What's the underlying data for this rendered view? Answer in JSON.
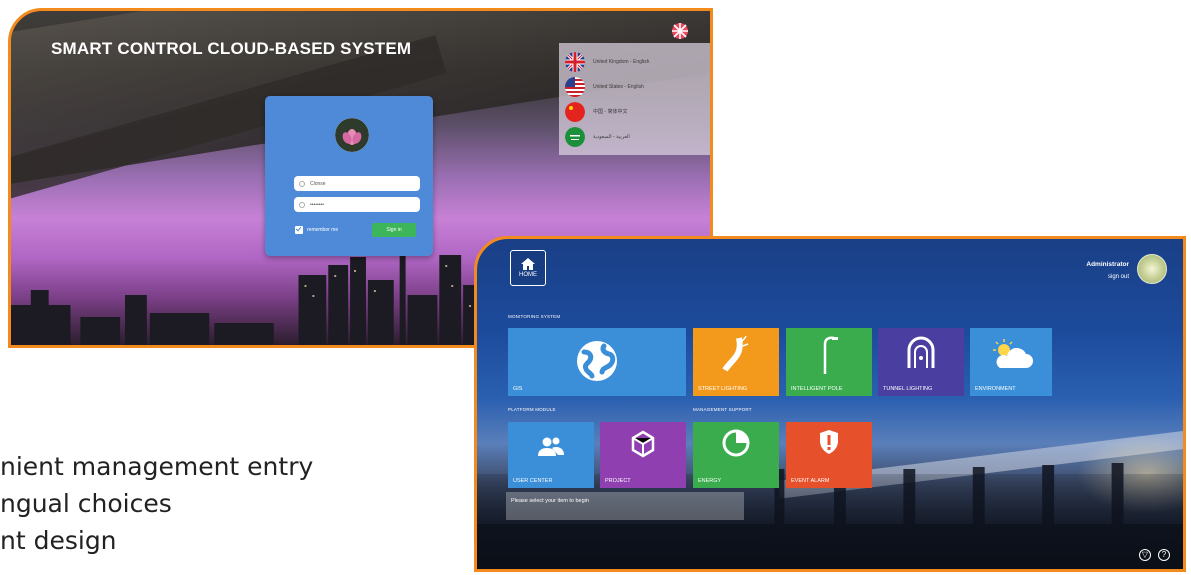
{
  "login": {
    "title": "SMART CONTROL CLOUD-BASED SYSTEM",
    "languages": [
      {
        "label": "United Kingdom - English",
        "flag": "uk-flag-icon"
      },
      {
        "label": "United States - English",
        "flag": "us-flag-icon"
      },
      {
        "label": "中国 - 简体中文",
        "flag": "cn-flag-icon"
      },
      {
        "label": "العربية - السعودية",
        "flag": "sa-flag-icon"
      }
    ],
    "username_value": "Clonse",
    "password_value": "••••••••",
    "remember_label": "remember me",
    "signin_label": "Sign in"
  },
  "dashboard": {
    "home_label": "HOME",
    "user_name": "Administrator",
    "sign_out_label": "sign out",
    "sections": {
      "monitoring": "MONITORING SYSTEM",
      "platform": "PLATFORM MODULE",
      "management": "MANAGEMENT SUPPORT"
    },
    "tiles": {
      "gis": "GIS",
      "street_lighting": "STREET LIGHTING",
      "intelligent_pole": "INTELLIGENT POLE",
      "tunnel_lighting": "TUNNEL LIGHTING",
      "environment": "ENVIRONMENT",
      "user_center": "USER CENTER",
      "project": "PROJECT",
      "energy": "ENERGY",
      "event_alarm": "EVENT ALARM"
    },
    "status_text": "Please select your item to begin",
    "colors": {
      "tile_blue": "#3a8fd8",
      "tile_orange": "#f39a1c",
      "tile_green": "#3aac4e",
      "tile_purple": "#8f3fb0",
      "tile_red": "#e6502b"
    }
  },
  "bullets": [
    "nient management entry",
    "ngual choices",
    "nt design"
  ],
  "frame_color": "#f28a1e"
}
